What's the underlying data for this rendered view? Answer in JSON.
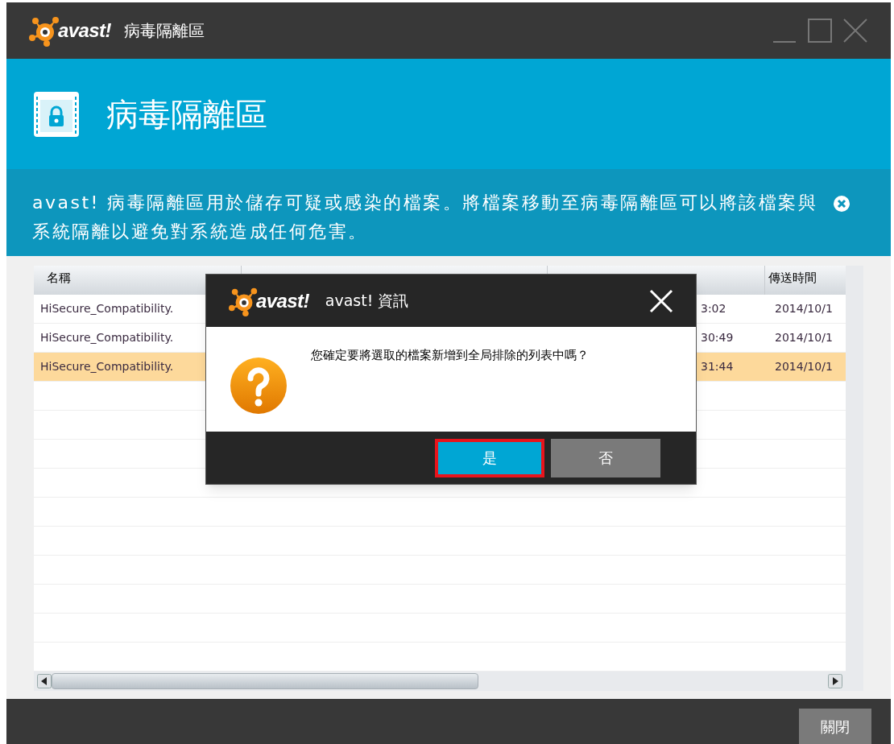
{
  "window": {
    "logo": "avast!",
    "title": "病毒隔離區"
  },
  "header": {
    "title": "病毒隔離區"
  },
  "description": {
    "text": "avast! 病毒隔離區用於儲存可疑或感染的檔案。將檔案移動至病毒隔離區可以將該檔案與系統隔離以避免對系統造成任何危害。"
  },
  "table": {
    "columns": {
      "name": "名稱",
      "sent_time": "傳送時間"
    },
    "rows": [
      {
        "name": "HiSecure_Compatibility.",
        "column_3": "3:02",
        "sent_time": "2014/10/1",
        "selected": false
      },
      {
        "name": "HiSecure_Compatibility.",
        "column_3": "30:49",
        "sent_time": "2014/10/1",
        "selected": false
      },
      {
        "name": "HiSecure_Compatibility.",
        "column_3": "31:44",
        "sent_time": "2014/10/1",
        "selected": true
      }
    ]
  },
  "dialog": {
    "logo": "avast!",
    "title": "avast! 資訊",
    "message": "您確定要將選取的檔案新增到全局排除的列表中嗎？",
    "buttons": [
      {
        "label": "是",
        "kind": "primary",
        "highlighted": true
      },
      {
        "label": "否",
        "kind": "secondary",
        "highlighted": false
      }
    ]
  },
  "footer": {
    "button": "關閉"
  }
}
